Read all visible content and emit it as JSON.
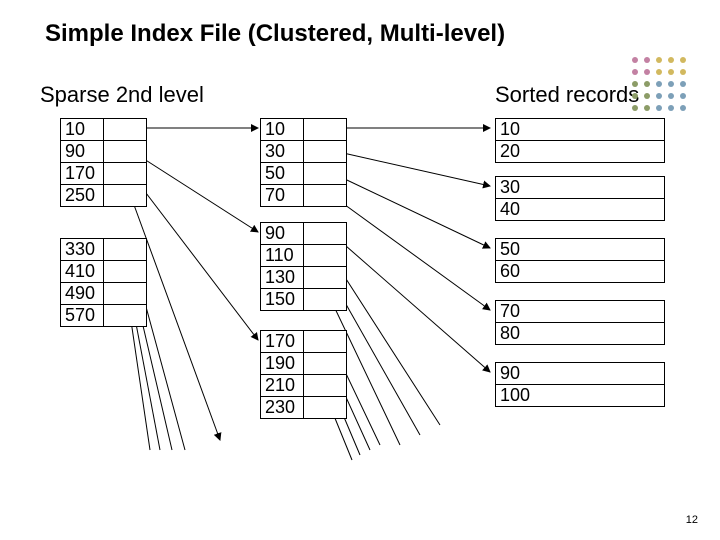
{
  "title": "Simple Index File (Clustered, Multi-level)",
  "labels": {
    "left": "Sparse 2nd level",
    "right": "Sorted records"
  },
  "sparse2": [
    [
      "10",
      "90",
      "170",
      "250"
    ],
    [
      "330",
      "410",
      "490",
      "570"
    ]
  ],
  "sparse1": [
    [
      "10",
      "30",
      "50",
      "70"
    ],
    [
      "90",
      "110",
      "130",
      "150"
    ],
    [
      "170",
      "190",
      "210",
      "230"
    ]
  ],
  "records": [
    [
      "10",
      "20"
    ],
    [
      "30",
      "40"
    ],
    [
      "50",
      "60"
    ],
    [
      "70",
      "80"
    ],
    [
      "90",
      "100"
    ]
  ],
  "page_number": "12"
}
